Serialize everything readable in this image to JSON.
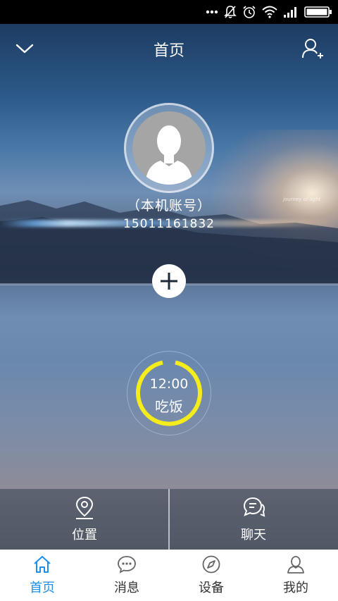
{
  "status_bar": {
    "icons": [
      "more-dots-icon",
      "notification-muted-icon",
      "alarm-icon",
      "wifi-icon",
      "signal-icon",
      "battery-icon"
    ]
  },
  "header": {
    "title": "首页",
    "left_icon": "chevron-down-icon",
    "right_icon": "add-user-icon"
  },
  "hero": {
    "background_caption": "journey of light"
  },
  "profile": {
    "account_label": "（本机账号）",
    "phone": "15011161832"
  },
  "reminder": {
    "time": "12:00",
    "label": "吃饭",
    "ring_color": "#f5ec1c"
  },
  "quick_actions": [
    {
      "label": "位置",
      "icon": "location-pin-icon"
    },
    {
      "label": "聊天",
      "icon": "chat-bubbles-icon"
    }
  ],
  "tabs": [
    {
      "label": "首页",
      "icon": "home-icon",
      "active": true
    },
    {
      "label": "消息",
      "icon": "message-icon",
      "active": false
    },
    {
      "label": "设备",
      "icon": "compass-icon",
      "active": false
    },
    {
      "label": "我的",
      "icon": "user-icon",
      "active": false
    }
  ],
  "colors": {
    "accent": "#1e8fe8",
    "tab_text": "#333333",
    "reminder_ring": "#f5ec1c"
  }
}
